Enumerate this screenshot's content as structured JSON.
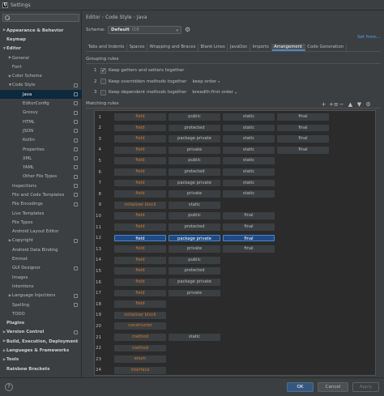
{
  "window": {
    "title": "Settings",
    "app_icon_letter": "IJ"
  },
  "sidebar": {
    "search_placeholder": "",
    "items": [
      {
        "label": "Appearance & Behavior",
        "bold": true,
        "arrow": "▶",
        "indent": 0,
        "copy": false,
        "selected": false
      },
      {
        "label": "Keymap",
        "bold": true,
        "arrow": "",
        "indent": 0,
        "copy": false,
        "selected": false
      },
      {
        "label": "Editor",
        "bold": true,
        "arrow": "▼",
        "indent": 0,
        "copy": false,
        "selected": false
      },
      {
        "label": "General",
        "bold": false,
        "arrow": "▶",
        "indent": 1,
        "copy": false,
        "selected": false
      },
      {
        "label": "Font",
        "bold": false,
        "arrow": "",
        "indent": 1,
        "copy": false,
        "selected": false
      },
      {
        "label": "Color Scheme",
        "bold": false,
        "arrow": "▶",
        "indent": 1,
        "copy": false,
        "selected": false
      },
      {
        "label": "Code Style",
        "bold": false,
        "arrow": "▼",
        "indent": 1,
        "copy": true,
        "selected": false
      },
      {
        "label": "Java",
        "bold": false,
        "arrow": "",
        "indent": 2,
        "copy": true,
        "selected": true
      },
      {
        "label": "EditorConfig",
        "bold": false,
        "arrow": "",
        "indent": 2,
        "copy": true,
        "selected": false
      },
      {
        "label": "Groovy",
        "bold": false,
        "arrow": "",
        "indent": 2,
        "copy": true,
        "selected": false
      },
      {
        "label": "HTML",
        "bold": false,
        "arrow": "",
        "indent": 2,
        "copy": true,
        "selected": false
      },
      {
        "label": "JSON",
        "bold": false,
        "arrow": "",
        "indent": 2,
        "copy": true,
        "selected": false
      },
      {
        "label": "Kotlin",
        "bold": false,
        "arrow": "",
        "indent": 2,
        "copy": true,
        "selected": false
      },
      {
        "label": "Properties",
        "bold": false,
        "arrow": "",
        "indent": 2,
        "copy": true,
        "selected": false
      },
      {
        "label": "XML",
        "bold": false,
        "arrow": "",
        "indent": 2,
        "copy": true,
        "selected": false
      },
      {
        "label": "YAML",
        "bold": false,
        "arrow": "",
        "indent": 2,
        "copy": true,
        "selected": false
      },
      {
        "label": "Other File Types",
        "bold": false,
        "arrow": "",
        "indent": 2,
        "copy": true,
        "selected": false
      },
      {
        "label": "Inspections",
        "bold": false,
        "arrow": "",
        "indent": 1,
        "copy": true,
        "selected": false
      },
      {
        "label": "File and Code Templates",
        "bold": false,
        "arrow": "",
        "indent": 1,
        "copy": true,
        "selected": false
      },
      {
        "label": "File Encodings",
        "bold": false,
        "arrow": "",
        "indent": 1,
        "copy": true,
        "selected": false
      },
      {
        "label": "Live Templates",
        "bold": false,
        "arrow": "",
        "indent": 1,
        "copy": false,
        "selected": false
      },
      {
        "label": "File Types",
        "bold": false,
        "arrow": "",
        "indent": 1,
        "copy": false,
        "selected": false
      },
      {
        "label": "Android Layout Editor",
        "bold": false,
        "arrow": "",
        "indent": 1,
        "copy": false,
        "selected": false
      },
      {
        "label": "Copyright",
        "bold": false,
        "arrow": "▶",
        "indent": 1,
        "copy": true,
        "selected": false
      },
      {
        "label": "Android Data Binding",
        "bold": false,
        "arrow": "",
        "indent": 1,
        "copy": false,
        "selected": false
      },
      {
        "label": "Emmet",
        "bold": false,
        "arrow": "",
        "indent": 1,
        "copy": false,
        "selected": false
      },
      {
        "label": "GUI Designer",
        "bold": false,
        "arrow": "",
        "indent": 1,
        "copy": true,
        "selected": false
      },
      {
        "label": "Images",
        "bold": false,
        "arrow": "",
        "indent": 1,
        "copy": false,
        "selected": false
      },
      {
        "label": "Intentions",
        "bold": false,
        "arrow": "",
        "indent": 1,
        "copy": false,
        "selected": false
      },
      {
        "label": "Language Injections",
        "bold": false,
        "arrow": "▶",
        "indent": 1,
        "copy": true,
        "selected": false
      },
      {
        "label": "Spelling",
        "bold": false,
        "arrow": "",
        "indent": 1,
        "copy": true,
        "selected": false
      },
      {
        "label": "TODO",
        "bold": false,
        "arrow": "",
        "indent": 1,
        "copy": false,
        "selected": false
      },
      {
        "label": "Plugins",
        "bold": true,
        "arrow": "",
        "indent": 0,
        "copy": false,
        "selected": false
      },
      {
        "label": "Version Control",
        "bold": true,
        "arrow": "▶",
        "indent": 0,
        "copy": true,
        "selected": false
      },
      {
        "label": "Build, Execution, Deployment",
        "bold": true,
        "arrow": "▶",
        "indent": 0,
        "copy": false,
        "selected": false
      },
      {
        "label": "Languages & Frameworks",
        "bold": true,
        "arrow": "▶",
        "indent": 0,
        "copy": false,
        "selected": false
      },
      {
        "label": "Tools",
        "bold": true,
        "arrow": "▶",
        "indent": 0,
        "copy": false,
        "selected": false
      },
      {
        "label": "Rainbow Brackets",
        "bold": true,
        "arrow": "",
        "indent": 0,
        "copy": false,
        "selected": false
      }
    ]
  },
  "breadcrumb": [
    "Editor",
    "Code Style",
    "Java"
  ],
  "breadcrumb_sep": "›",
  "scheme": {
    "label": "Scheme:",
    "value": "Default",
    "suffix": "IDE",
    "chevron": "▾"
  },
  "set_from": "Set from...",
  "tabs": [
    {
      "label": "Tabs and Indents",
      "active": false
    },
    {
      "label": "Spaces",
      "active": false
    },
    {
      "label": "Wrapping and Braces",
      "active": false
    },
    {
      "label": "Blank Lines",
      "active": false
    },
    {
      "label": "JavaDoc",
      "active": false
    },
    {
      "label": "Imports",
      "active": false
    },
    {
      "label": "Arrangement",
      "active": true
    },
    {
      "label": "Code Generation",
      "active": false
    }
  ],
  "grouping": {
    "title": "Grouping rules",
    "rules": [
      {
        "num": "1",
        "checked": true,
        "text": "Keep getters and setters together",
        "select": ""
      },
      {
        "num": "2",
        "checked": false,
        "text": "Keep overridden methods together",
        "select": "keep order"
      },
      {
        "num": "3",
        "checked": false,
        "text": "Keep dependent methods together",
        "select": "breadth-first order"
      }
    ]
  },
  "matching": {
    "title": "Matching rules",
    "toolbar": [
      {
        "name": "add-rule-icon",
        "glyph": "+"
      },
      {
        "name": "add-section-icon",
        "glyph": "+≡"
      },
      {
        "name": "remove-rule-icon",
        "glyph": "−"
      },
      {
        "name": "move-up-icon",
        "glyph": "▲"
      },
      {
        "name": "move-down-icon",
        "glyph": "▼"
      },
      {
        "name": "settings-icon",
        "glyph": "⚙"
      }
    ],
    "rows": [
      {
        "num": "1",
        "kind": "field",
        "c2": "public",
        "c3": "static",
        "c4": "final"
      },
      {
        "num": "2",
        "kind": "field",
        "c2": "protected",
        "c3": "static",
        "c4": "final"
      },
      {
        "num": "3",
        "kind": "field",
        "c2": "package private",
        "c3": "static",
        "c4": "final"
      },
      {
        "num": "4",
        "kind": "field",
        "c2": "private",
        "c3": "static",
        "c4": "final"
      },
      {
        "num": "5",
        "kind": "field",
        "c2": "public",
        "c3": "static",
        "c4": ""
      },
      {
        "num": "6",
        "kind": "field",
        "c2": "protected",
        "c3": "static",
        "c4": ""
      },
      {
        "num": "7",
        "kind": "field",
        "c2": "package private",
        "c3": "static",
        "c4": ""
      },
      {
        "num": "8",
        "kind": "field",
        "c2": "private",
        "c3": "static",
        "c4": ""
      },
      {
        "num": "9",
        "kind": "initializer block",
        "c2": "static",
        "c3": "",
        "c4": ""
      },
      {
        "num": "10",
        "kind": "field",
        "c2": "public",
        "c3": "final",
        "c4": ""
      },
      {
        "num": "11",
        "kind": "field",
        "c2": "protected",
        "c3": "final",
        "c4": ""
      },
      {
        "num": "12",
        "kind": "field",
        "c2": "package private",
        "c3": "final",
        "c4": "",
        "selected": true
      },
      {
        "num": "13",
        "kind": "field",
        "c2": "private",
        "c3": "final",
        "c4": ""
      },
      {
        "num": "14",
        "kind": "field",
        "c2": "public",
        "c3": "",
        "c4": ""
      },
      {
        "num": "15",
        "kind": "field",
        "c2": "protected",
        "c3": "",
        "c4": ""
      },
      {
        "num": "16",
        "kind": "field",
        "c2": "package private",
        "c3": "",
        "c4": ""
      },
      {
        "num": "17",
        "kind": "field",
        "c2": "private",
        "c3": "",
        "c4": ""
      },
      {
        "num": "18",
        "kind": "field",
        "c2": "",
        "c3": "",
        "c4": ""
      },
      {
        "num": "19",
        "kind": "initializer block",
        "c2": "",
        "c3": "",
        "c4": ""
      },
      {
        "num": "20",
        "kind": "constructor",
        "c2": "",
        "c3": "",
        "c4": ""
      },
      {
        "num": "21",
        "kind": "method",
        "c2": "static",
        "c3": "",
        "c4": ""
      },
      {
        "num": "22",
        "kind": "method",
        "c2": "",
        "c3": "",
        "c4": ""
      },
      {
        "num": "23",
        "kind": "enum",
        "c2": "",
        "c3": "",
        "c4": ""
      },
      {
        "num": "24",
        "kind": "interface",
        "c2": "",
        "c3": "",
        "c4": ""
      }
    ]
  },
  "buttons": {
    "help": "?",
    "ok": "OK",
    "cancel": "Cancel",
    "apply": "Apply"
  },
  "colors": {
    "accent": "#4a88c7",
    "kind_text": "#cc7832",
    "link": "#589df6",
    "selection": "#0d293e"
  }
}
